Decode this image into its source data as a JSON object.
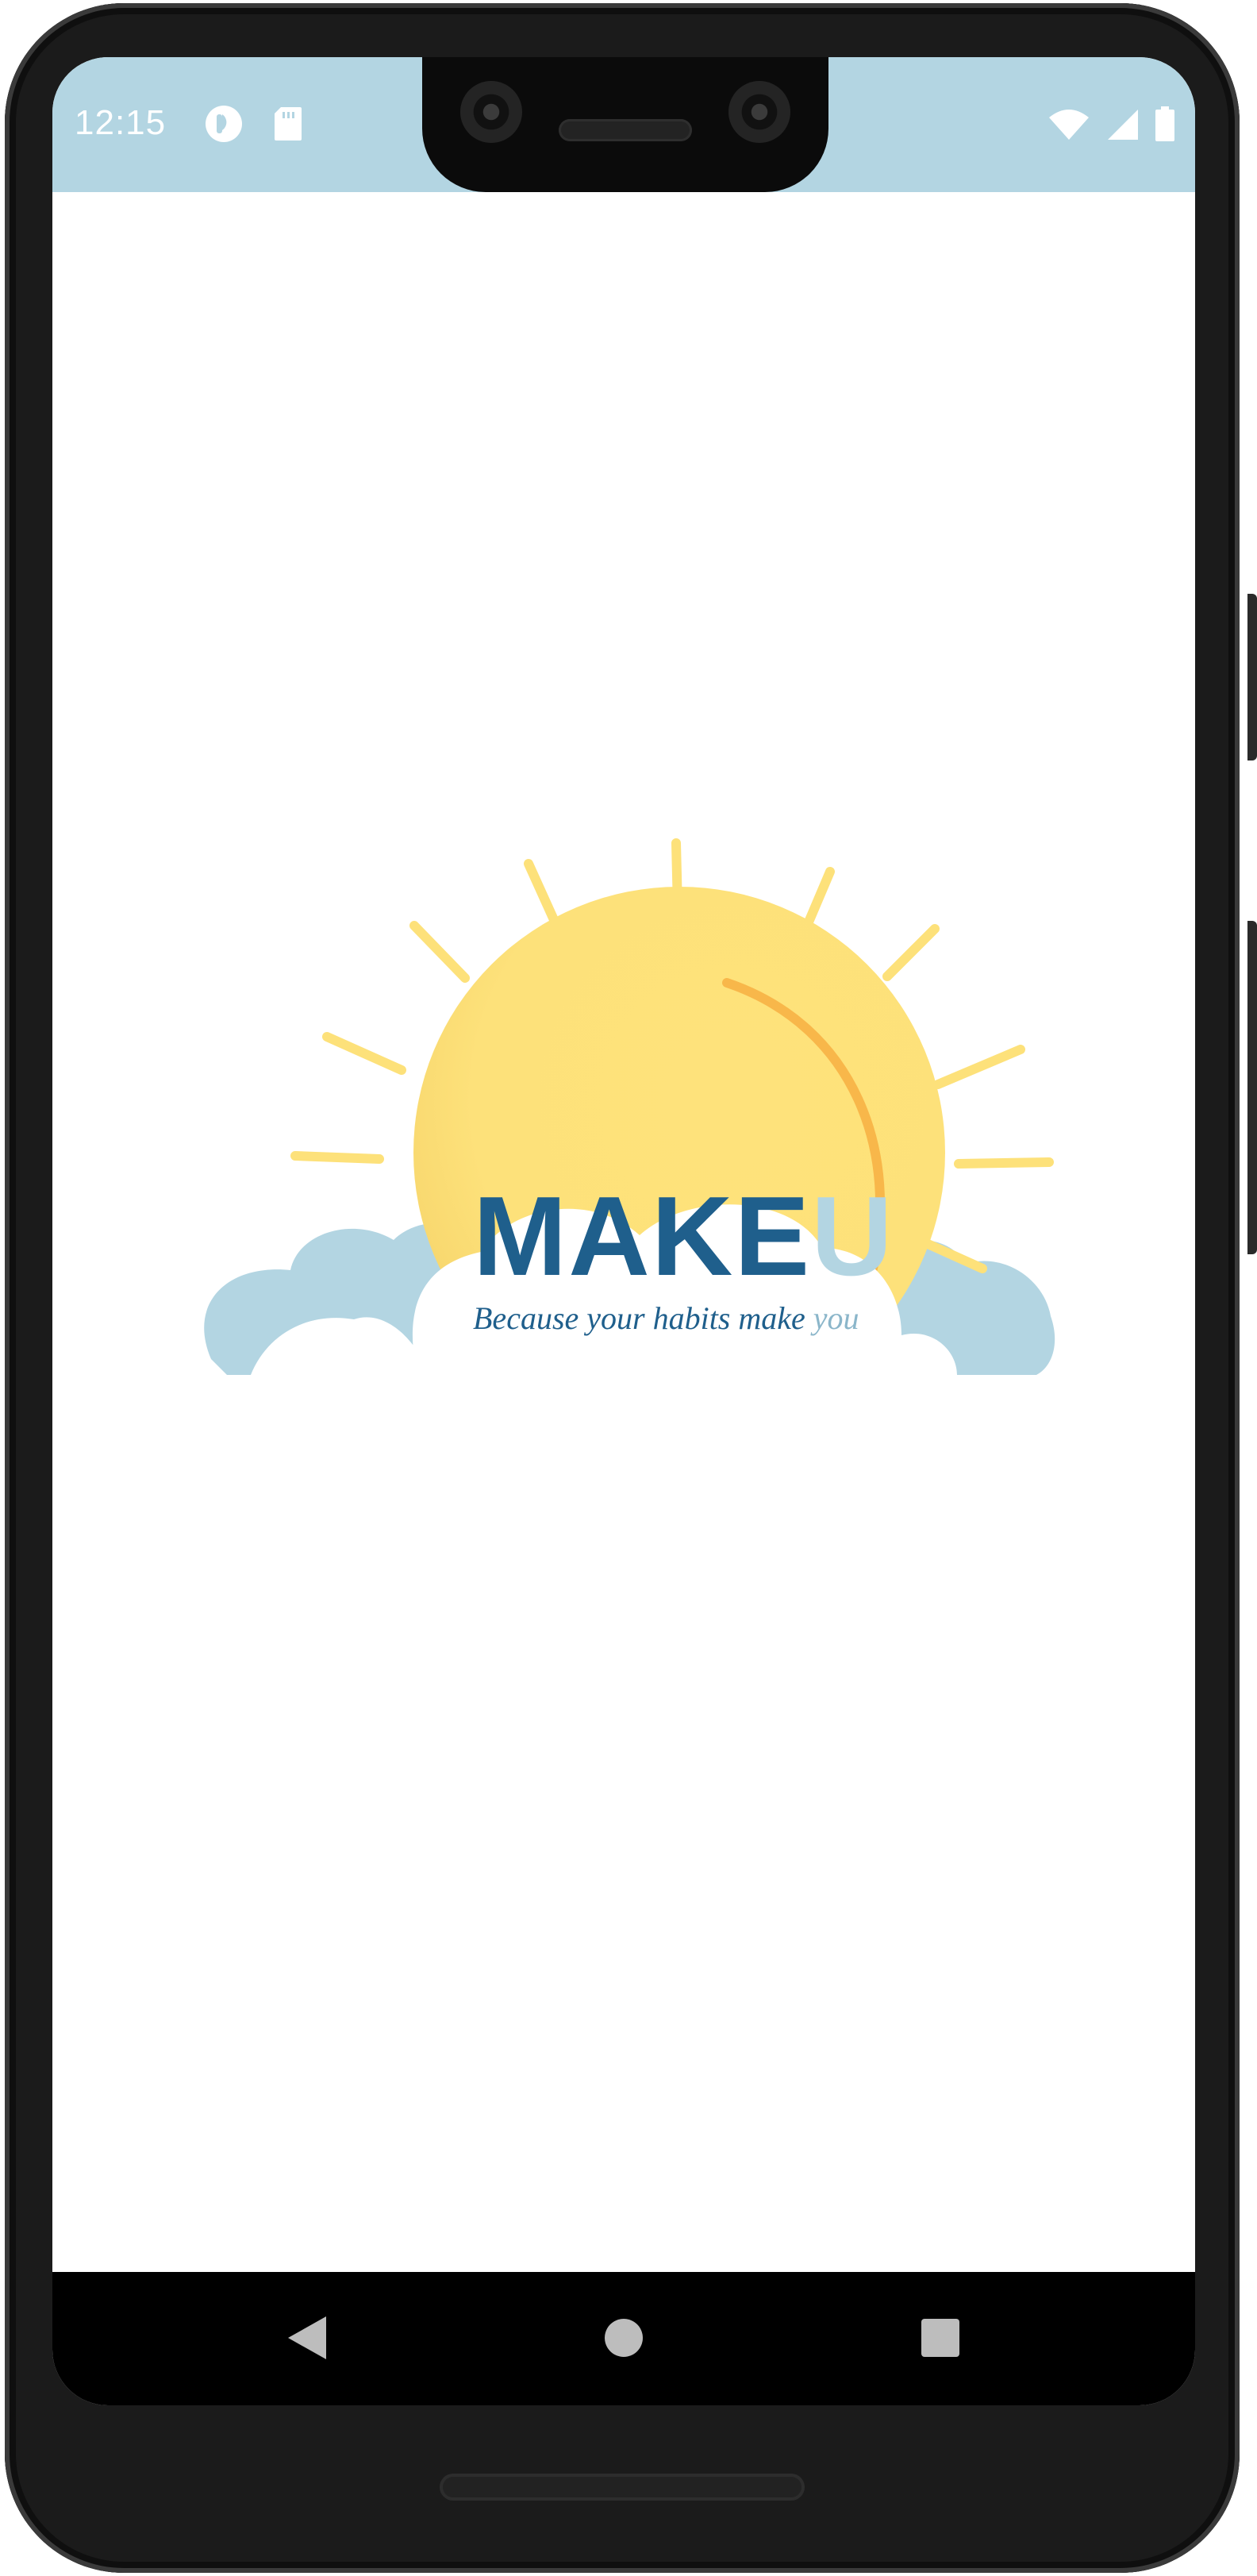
{
  "status_bar": {
    "time": "12:15",
    "background_color": "#b3d5e2",
    "left_icons": [
      "app-notification-icon",
      "sd-card-icon"
    ],
    "right_icons": [
      "wifi-icon",
      "cellular-signal-icon",
      "battery-icon"
    ]
  },
  "splash": {
    "brand_name_primary": "MAKE",
    "brand_name_accent": "U",
    "tagline_main": "Because your habits make",
    "tagline_accent": "you",
    "brand_color": "#1f5f8c",
    "accent_color": "#b3d5e2",
    "sun_color": "#fde17a",
    "cloud_color": "#b3d5e2"
  },
  "navigation_bar": {
    "buttons": [
      "back-icon",
      "home-icon",
      "recents-icon"
    ]
  }
}
